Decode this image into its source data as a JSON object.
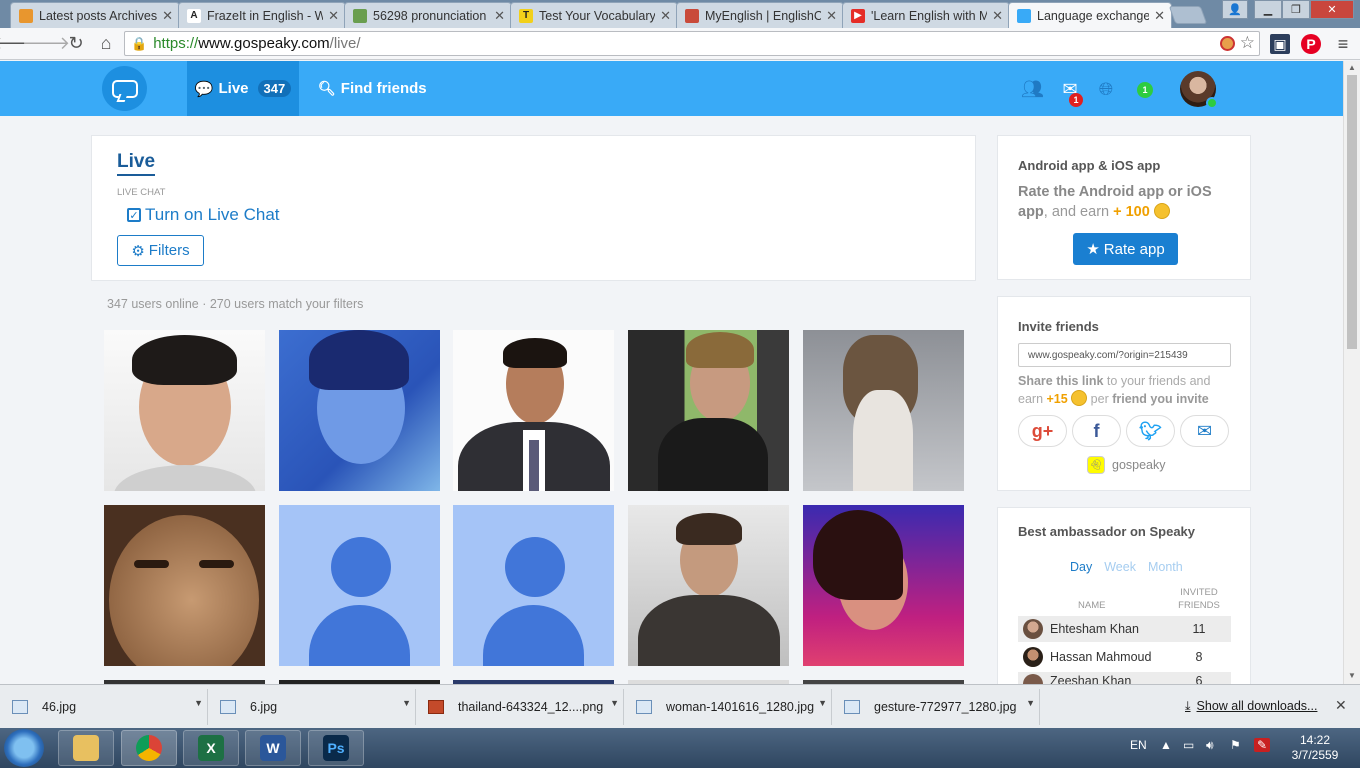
{
  "browser": {
    "tabs": [
      {
        "title": "Latest posts Archives",
        "fav_color": "#e8962e"
      },
      {
        "title": "FrazeIt in English - W",
        "fav_color": "#444444"
      },
      {
        "title": "56298 pronunciation",
        "fav_color": "#6a9e4f"
      },
      {
        "title": "Test Your Vocabulary",
        "fav_color": "#f2d01a"
      },
      {
        "title": "MyEnglish | EnglishC",
        "fav_color": "#c94a3a"
      },
      {
        "title": "'Learn English with M",
        "fav_color": "#e52d27"
      },
      {
        "title": "Language exchange",
        "fav_color": "#39aaf7"
      }
    ],
    "url": {
      "scheme": "https://",
      "host": "www.gospeaky.com",
      "path": "/live/"
    }
  },
  "header": {
    "live_label": "Live",
    "live_count": "347",
    "find_friends_label": "Find friends",
    "messages_badge": "1",
    "notif_badge": "1"
  },
  "main": {
    "title": "Live",
    "live_chat_label": "LIVE CHAT",
    "turn_on_label": "Turn on Live Chat",
    "filters_label": "Filters",
    "users_summary": "347 users online · 270 users match your filters"
  },
  "sidebar": {
    "app": {
      "heading": "Android app & iOS app",
      "rate_bold": "Rate the Android app or iOS app",
      "rate_rest": ", and earn ",
      "rate_reward": "+ 100",
      "rate_button": "Rate app"
    },
    "invite": {
      "heading": "Invite friends",
      "link": "www.gospeaky.com/?origin=215439",
      "share_bold": "Share this link",
      "share_mid": " to your friends and earn ",
      "share_reward": "+15",
      "share_per": " per ",
      "share_bold2": "friend you invite",
      "snapchat_name": "gospeaky"
    },
    "ambassador": {
      "heading": "Best ambassador on Speaky",
      "periods": [
        "Day",
        "Week",
        "Month"
      ],
      "col_name": "NAME",
      "col_invited": "INVITED FRIENDS",
      "rows": [
        {
          "name": "Ehtesham Khan",
          "value": "11"
        },
        {
          "name": "Hassan Mahmoud",
          "value": "8"
        },
        {
          "name": "Zeeshan Khan",
          "value": "6"
        }
      ]
    }
  },
  "downloads": {
    "items": [
      "46.jpg",
      "6.jpg",
      "thailand-643324_12....png",
      "woman-1401616_1280.jpg",
      "gesture-772977_1280.jpg"
    ],
    "show_all": "Show all downloads..."
  },
  "taskbar": {
    "lang": "EN",
    "time": "14:22",
    "date": "3/7/2559"
  }
}
